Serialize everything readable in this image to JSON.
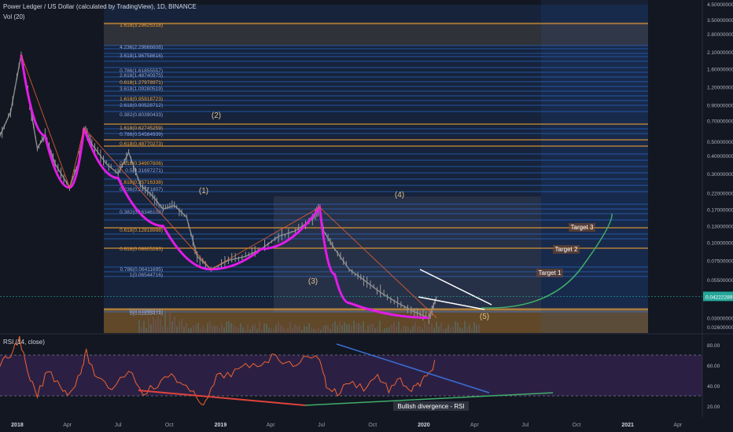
{
  "header": {
    "title": "Power Ledger / US Dollar (calculated by TradingView), 1D, BINANCE",
    "vol_label": "Vol (20)",
    "rsi_label": "RSI (14, close)"
  },
  "colors": {
    "background": "#131722",
    "candles": "#8a8a8a",
    "wave": "#e11ce6",
    "trend": "#f0622f",
    "projection": "#3fae6a",
    "fib_blue": "#2e6fd8",
    "fib_orange": "#f2a233",
    "rsi_line": "#f0622f",
    "rsi_band": "#4a2d6e",
    "support_red": "#e0433c",
    "support_green": "#3fae6a",
    "resistance_blue": "#3b6ed6",
    "price_badge": "#26a69a"
  },
  "chart_data": [
    {
      "type": "line",
      "title": "Power Ledger / US Dollar (calculated by TradingView), 1D, BINANCE",
      "scale": "log",
      "ylim": [
        0.026,
        4.5
      ],
      "x_ticks": [
        "2018",
        "Apr",
        "Jul",
        "Oct",
        "2019",
        "Apr",
        "Jul",
        "Oct",
        "2020",
        "Apr",
        "Jul",
        "Oct",
        "2021",
        "Apr"
      ],
      "y_ticks": [
        "4.50000000",
        "3.50000000",
        "2.80000000",
        "2.10000000",
        "1.60000000",
        "1.20000000",
        "0.90000000",
        "0.70000000",
        "0.50000000",
        "0.40000000",
        "0.30000000",
        "0.22000000",
        "0.17000000",
        "0.13000000",
        "0.10000000",
        "0.07500000",
        "0.05500000",
        "0.03000000",
        "0.02600000"
      ],
      "current_price": "0.04222289",
      "wave_labels": [
        "(1)",
        "(2)",
        "(3)",
        "(4)",
        "(5)"
      ],
      "targets": [
        "Target 1",
        "Target 2",
        "Target 3"
      ],
      "fib_labels": [
        "1.618(3.29625318)",
        "4.236(2.29666608)",
        "3.618(1.96758616)",
        "0.786(1.61855557)",
        "2.618(1.48740975)",
        "0.618(1.27978971)",
        "3.618(1.09280519)",
        "1.618(0.95918723)",
        "2.618(0.90528712)",
        "0.382(0.80390433)",
        "1.618(0.62745259)",
        "0.786(0.54584939)",
        "0.618(0.48770273)",
        "0.618(0.34907806)",
        "0.5(0.31697271)",
        "1.618(0.25716338)",
        "0.236(0.22771807)",
        "0.382(0.16346108)",
        "0.618(0.12818998)",
        "0.618(0.08605283)",
        "0.786(0.06411695)",
        "1(0.06544716)",
        "0(0.02996474)",
        "0(0.02839474)"
      ],
      "close_path": [
        [
          "2017-12-01",
          0.55
        ],
        [
          "2017-12-20",
          0.8
        ],
        [
          "2018-01-08",
          2.0
        ],
        [
          "2018-01-20",
          1.1
        ],
        [
          "2018-02-06",
          0.45
        ],
        [
          "2018-02-20",
          0.55
        ],
        [
          "2018-03-10",
          0.35
        ],
        [
          "2018-04-05",
          0.24
        ],
        [
          "2018-04-20",
          0.35
        ],
        [
          "2018-05-01",
          0.62
        ],
        [
          "2018-05-15",
          0.48
        ],
        [
          "2018-06-10",
          0.35
        ],
        [
          "2018-07-01",
          0.3
        ],
        [
          "2018-07-20",
          0.42
        ],
        [
          "2018-08-10",
          0.25
        ],
        [
          "2018-09-01",
          0.21
        ],
        [
          "2018-09-20",
          0.17
        ],
        [
          "2018-10-10",
          0.18
        ],
        [
          "2018-11-01",
          0.15
        ],
        [
          "2018-11-20",
          0.08
        ],
        [
          "2018-12-15",
          0.065
        ],
        [
          "2019-01-15",
          0.075
        ],
        [
          "2019-02-15",
          0.08
        ],
        [
          "2019-03-15",
          0.09
        ],
        [
          "2019-04-15",
          0.11
        ],
        [
          "2019-05-15",
          0.12
        ],
        [
          "2019-06-15",
          0.145
        ],
        [
          "2019-06-28",
          0.175
        ],
        [
          "2019-07-05",
          0.12
        ],
        [
          "2019-07-25",
          0.09
        ],
        [
          "2019-08-20",
          0.065
        ],
        [
          "2019-09-15",
          0.055
        ],
        [
          "2019-10-15",
          0.045
        ],
        [
          "2019-11-15",
          0.038
        ],
        [
          "2019-12-15",
          0.033
        ],
        [
          "2020-01-10",
          0.03
        ],
        [
          "2020-01-24",
          0.0422
        ]
      ]
    },
    {
      "type": "line",
      "title": "RSI (14, close)",
      "ylim": [
        10,
        90
      ],
      "y_ticks": [
        80,
        60,
        40,
        20
      ],
      "levels": [
        70,
        30
      ],
      "annotation": "Bullish divergence - RSI",
      "values_path": [
        [
          "2017-12-01",
          60
        ],
        [
          "2017-12-20",
          70
        ],
        [
          "2018-01-05",
          88
        ],
        [
          "2018-01-20",
          50
        ],
        [
          "2018-02-06",
          30
        ],
        [
          "2018-02-25",
          55
        ],
        [
          "2018-03-20",
          40
        ],
        [
          "2018-04-05",
          31
        ],
        [
          "2018-04-25",
          55
        ],
        [
          "2018-05-05",
          72
        ],
        [
          "2018-05-25",
          45
        ],
        [
          "2018-06-20",
          38
        ],
        [
          "2018-07-20",
          56
        ],
        [
          "2018-08-15",
          34
        ],
        [
          "2018-09-10",
          40
        ],
        [
          "2018-10-05",
          52
        ],
        [
          "2018-10-25",
          40
        ],
        [
          "2018-11-20",
          28
        ],
        [
          "2018-12-05",
          22
        ],
        [
          "2018-12-25",
          48
        ],
        [
          "2019-01-20",
          52
        ],
        [
          "2019-02-15",
          58
        ],
        [
          "2019-03-15",
          62
        ],
        [
          "2019-04-10",
          70
        ],
        [
          "2019-05-05",
          60
        ],
        [
          "2019-05-30",
          66
        ],
        [
          "2019-06-28",
          68
        ],
        [
          "2019-07-10",
          40
        ],
        [
          "2019-07-30",
          32
        ],
        [
          "2019-08-20",
          44
        ],
        [
          "2019-09-15",
          38
        ],
        [
          "2019-10-10",
          50
        ],
        [
          "2019-10-30",
          36
        ],
        [
          "2019-11-20",
          45
        ],
        [
          "2019-12-10",
          35
        ],
        [
          "2019-12-25",
          42
        ],
        [
          "2020-01-10",
          50
        ],
        [
          "2020-01-24",
          68
        ]
      ]
    }
  ]
}
